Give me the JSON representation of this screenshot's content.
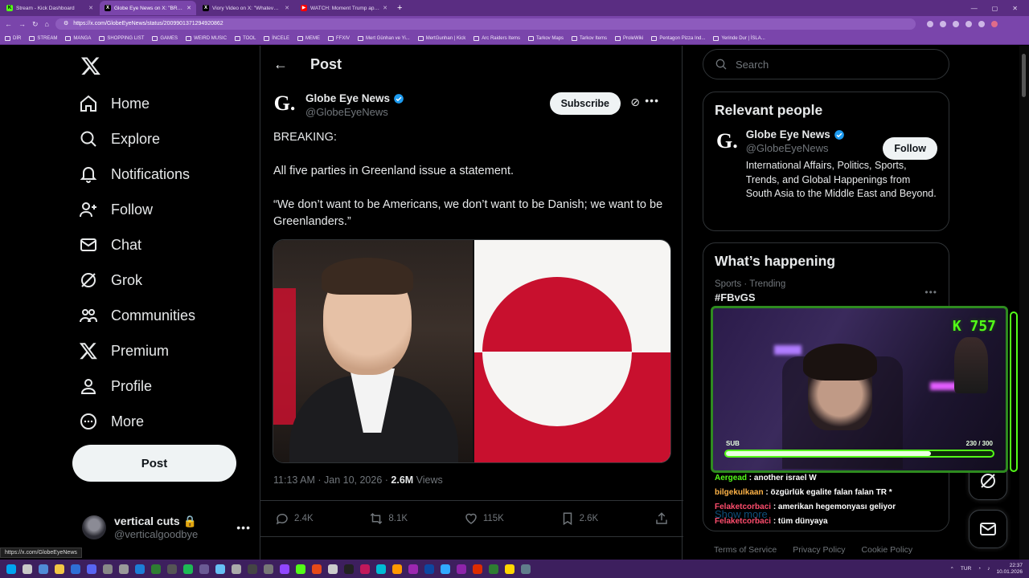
{
  "browser": {
    "tabs": [
      {
        "title": "Stream - Kick Dashboard",
        "active": false,
        "favicon_color": "#53fc18"
      },
      {
        "title": "Globe Eye News on X: \"BREAKING:",
        "active": true,
        "favicon_color": "#000000"
      },
      {
        "title": "Viory Video on X: \"Whatever you",
        "active": false,
        "favicon_color": "#000000"
      },
      {
        "title": "WATCH: Moment Trump appears",
        "active": false,
        "favicon_color": "#ff0000"
      }
    ],
    "url": "https://x.com/GlobeEyeNews/status/2009901371294920862",
    "bookmarks": [
      "DİR",
      "STREAM",
      "MANGA",
      "SHOPPING LIST",
      "GAMES",
      "WEIRD MUSIC",
      "TOOL",
      "İNCELE",
      "MEME",
      "FFXIV",
      "Mert Günhan ve Yi...",
      "MertGunhan | Kick",
      "Arc Raiders Items",
      "Tarkov Maps",
      "Tarkov Items",
      "ProleWiki",
      "Pentagon Pizza Ind...",
      "Yerinde Dur | İSLA..."
    ],
    "status_link": "https://x.com/GlobeEyeNews"
  },
  "nav": {
    "items": [
      "Home",
      "Explore",
      "Notifications",
      "Follow",
      "Chat",
      "Grok",
      "Communities",
      "Premium",
      "Profile",
      "More"
    ],
    "icons": [
      "home-icon",
      "explore-icon",
      "notifications-icon",
      "follow-icon",
      "chat-icon",
      "grok-icon",
      "communities-icon",
      "premium-icon",
      "profile-icon",
      "more-icon"
    ],
    "post_button": "Post",
    "account_name": "vertical cuts",
    "account_handle": "@verticalgoodbye"
  },
  "post": {
    "header": "Post",
    "author_name": "Globe Eye News",
    "author_handle": "@GlobeEyeNews",
    "subscribe": "Subscribe",
    "paragraphs": [
      "BREAKING:",
      "All five parties in Greenland issue a statement.",
      "“We don’t want to be Americans, we don’t want to be Danish; we want to be Greenlanders.”"
    ],
    "timestamp": "11:13 AM · Jan 10, 2026 · ",
    "views_count": "2.6M",
    "views_label": " Views",
    "replies": "2.4K",
    "reposts": "8.1K",
    "likes": "115K",
    "bookmarks": "2.6K"
  },
  "sidebar": {
    "search_placeholder": "Search",
    "relevant_title": "Relevant people",
    "person_name": "Globe Eye News",
    "person_handle": "@GlobeEyeNews",
    "person_bio": "International Affairs, Politics, Sports, Trends, and Global Happenings from South Asia to the Middle East and Beyond.",
    "follow": "Follow",
    "happening_title": "What’s happening",
    "trend_meta": "Sports · Trending",
    "trend_name": "#FBvGS",
    "show_more": "Show more",
    "footer_links": [
      "Terms of Service",
      "Privacy Policy",
      "Cookie Policy"
    ]
  },
  "stream": {
    "badge": "K 757",
    "sub_label": "SUB",
    "sub_count": "230 / 300",
    "sub_progress": 0.767,
    "chat": [
      {
        "user": "Aergead",
        "msg": " : another israel W",
        "cls": "u1"
      },
      {
        "user": "bilgekulkaan",
        "msg": " : özgürlük egalite falan falan TR *",
        "cls": "u2"
      },
      {
        "user": "Felaketcorbaci",
        "msg": " : amerikan hegemonyası geliyor",
        "cls": "u3"
      },
      {
        "user": "Felaketcorbaci",
        "msg": " : tüm dünyaya",
        "cls": "u3"
      }
    ]
  },
  "taskbar": {
    "lang": "TUR",
    "time": "22:37",
    "date": "10.01.2026"
  },
  "colors": {
    "x_blue": "#1d9bf0",
    "kick_green": "#53fc18",
    "greenland_red": "#c8102e",
    "chrome_purple": "#7a45ab"
  }
}
